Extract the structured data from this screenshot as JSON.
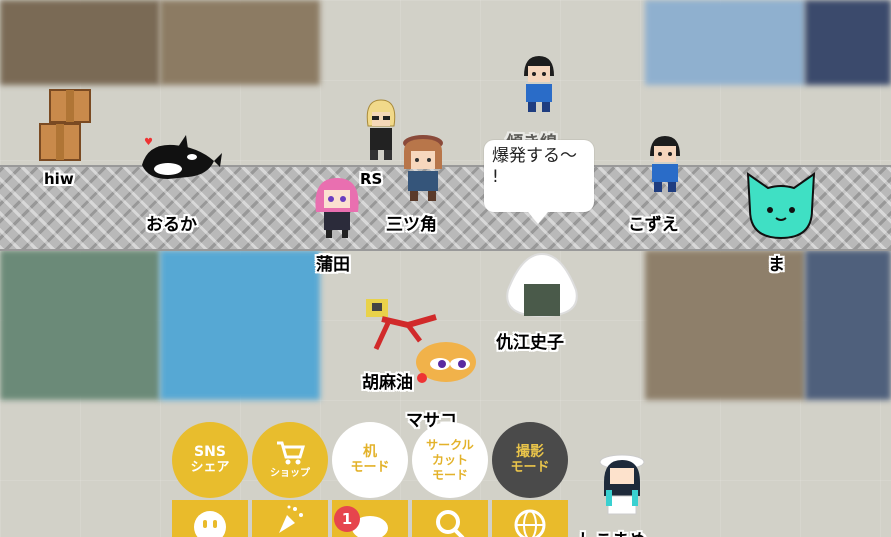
{
  "players": [
    {
      "id": "hiw",
      "name": "hiw",
      "avatar": "cardboard-boxes"
    },
    {
      "id": "oruka",
      "name": "おるか",
      "avatar": "orca"
    },
    {
      "id": "rs",
      "name": "RS",
      "avatar": "blonde-glasses-person"
    },
    {
      "id": "mitsukado",
      "name": "三ツ角",
      "avatar": "brown-hat-person"
    },
    {
      "id": "kamata",
      "name": "蒲田",
      "avatar": "pink-hair-girl"
    },
    {
      "id": "katamukisen",
      "name": "傾き線",
      "avatar": "blue-shirt-kid"
    },
    {
      "id": "kozue",
      "name": "こずえ",
      "avatar": "blue-shirt-kid"
    },
    {
      "id": "ma",
      "name": "ま",
      "avatar": "teal-cat"
    },
    {
      "id": "adashiko",
      "name": "仇江史子",
      "avatar": "onigiri"
    },
    {
      "id": "koma",
      "name": "胡麻油",
      "avatar": "running-man"
    },
    {
      "id": "maso",
      "name": "マサコ",
      "avatar": "orange-car"
    },
    {
      "id": "bottom-right",
      "name": "しこまめ",
      "avatar": "white-hat-girl"
    }
  ],
  "speech_bubble": {
    "text_line1": "爆発する〜",
    "text_line2": "!"
  },
  "round_buttons": [
    {
      "id": "sns",
      "line1": "SNS",
      "line2": "シェア"
    },
    {
      "id": "shop",
      "line1": "",
      "line2": "ショップ",
      "icon": "cart-icon"
    },
    {
      "id": "desk",
      "line1": "机",
      "line2": "モード"
    },
    {
      "id": "circle-cut",
      "line1": "サークル",
      "line2": "カット",
      "line3": "モード"
    },
    {
      "id": "photo",
      "line1": "撮影",
      "line2": "モード"
    }
  ],
  "bottom_tabs": [
    {
      "id": "face",
      "icon": "smiley-icon"
    },
    {
      "id": "party",
      "icon": "party-popper-icon"
    },
    {
      "id": "chat",
      "icon": "chat-bubble-icon",
      "badge": "1"
    },
    {
      "id": "search",
      "icon": "search-icon"
    },
    {
      "id": "globe",
      "icon": "globe-icon"
    }
  ],
  "colors": {
    "accent_yellow": "#e8bd2d",
    "badge_red": "#e6454d",
    "dark_button": "#4a4a4a",
    "cat_teal": "#3fe0c4"
  }
}
